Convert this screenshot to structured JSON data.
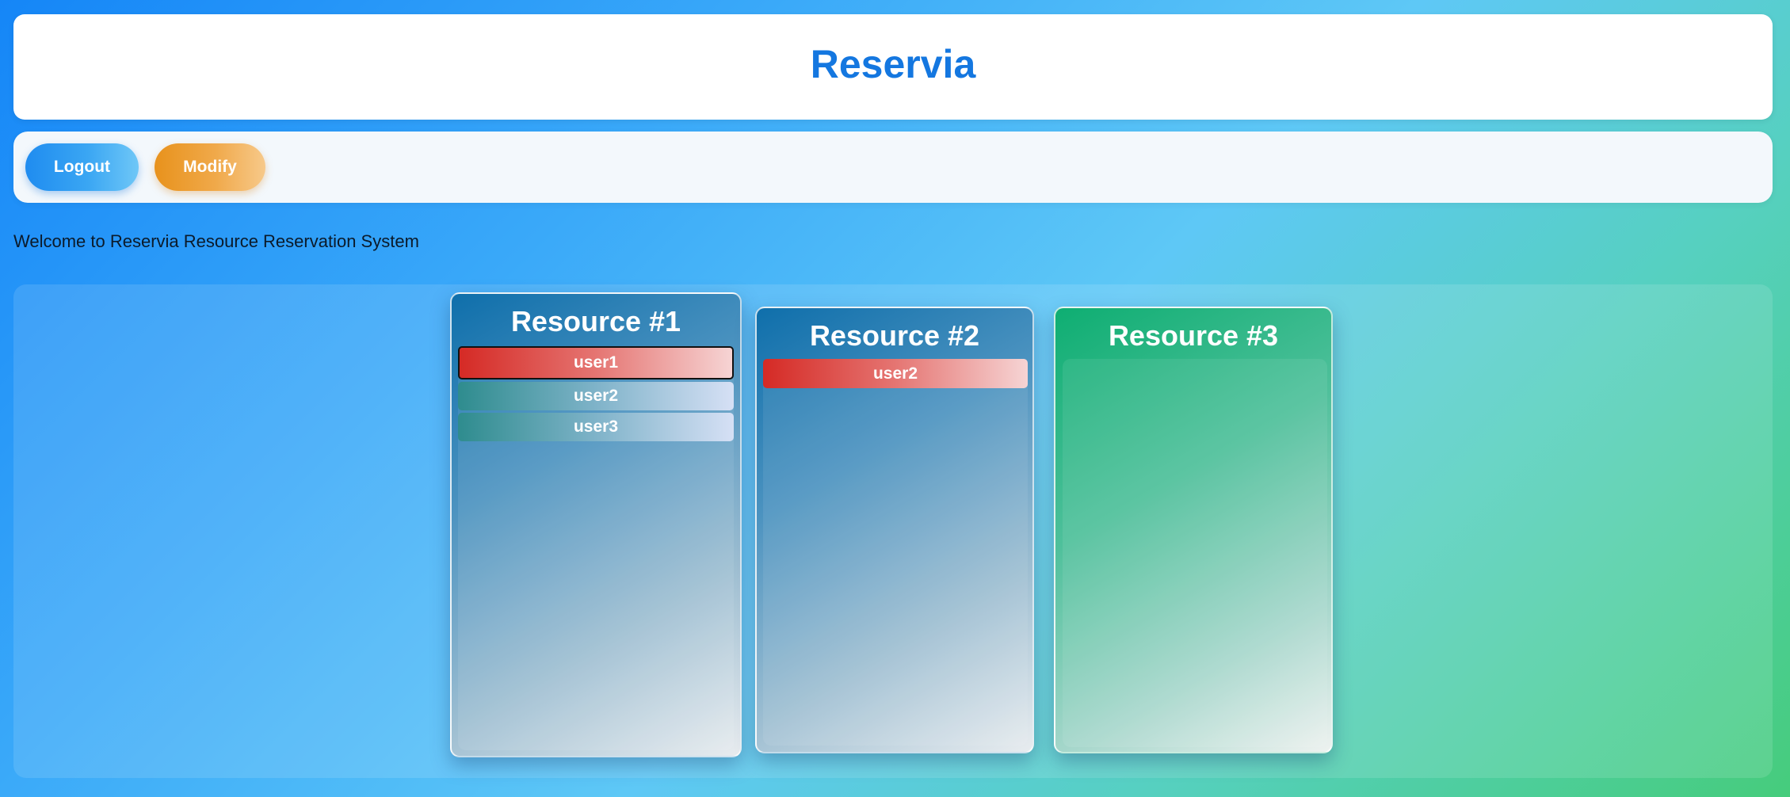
{
  "header": {
    "title": "Reservia"
  },
  "toolbar": {
    "logout_label": "Logout",
    "modify_label": "Modify"
  },
  "welcome_text": "Welcome to Reservia Resource Reservation System",
  "resources": [
    {
      "title": "Resource #1",
      "reservations": [
        {
          "user": "user1",
          "style": "red",
          "selected": true
        },
        {
          "user": "user2",
          "style": "teal",
          "selected": false
        },
        {
          "user": "user3",
          "style": "teal",
          "selected": false
        }
      ]
    },
    {
      "title": "Resource #2",
      "reservations": [
        {
          "user": "user2",
          "style": "red",
          "selected": false
        }
      ]
    },
    {
      "title": "Resource #3",
      "reservations": []
    }
  ],
  "colors": {
    "title": "#1477e0",
    "reservation_red": "#d52a25",
    "reservation_teal": "#2e8c8e",
    "resource_blue": "#0f6fab",
    "resource_green": "#0eae72"
  }
}
